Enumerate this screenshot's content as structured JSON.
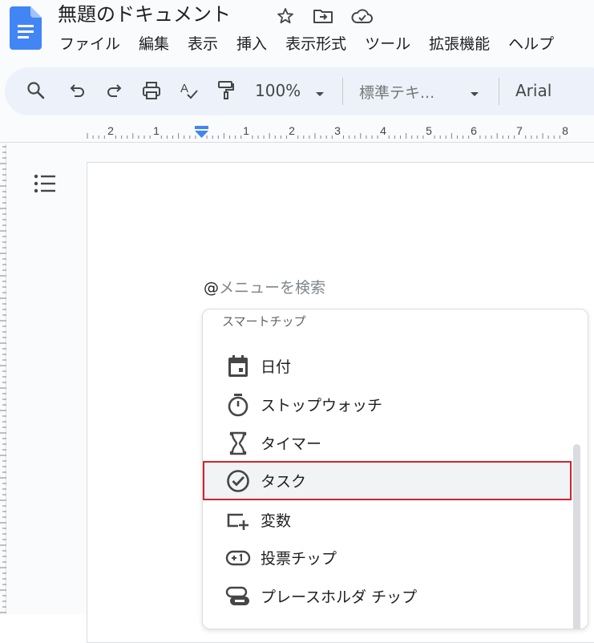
{
  "document": {
    "title": "無題のドキュメント"
  },
  "menu": {
    "items": [
      "ファイル",
      "編集",
      "表示",
      "挿入",
      "表示形式",
      "ツール",
      "拡張機能",
      "ヘルプ"
    ]
  },
  "toolbar": {
    "zoom": "100%",
    "paragraph_style": "標準テキ...",
    "font": "Arial"
  },
  "ruler": {
    "left_labels": [
      "2",
      "1"
    ],
    "right_labels": [
      "1",
      "2",
      "3",
      "4",
      "5",
      "6",
      "7",
      "8"
    ]
  },
  "editor": {
    "at_symbol": "@",
    "search_placeholder": "メニューを検索"
  },
  "smart_chips": {
    "section_label": "スマートチップ",
    "items": [
      {
        "label": "日付",
        "icon": "calendar-icon"
      },
      {
        "label": "ストップウォッチ",
        "icon": "stopwatch-icon"
      },
      {
        "label": "タイマー",
        "icon": "hourglass-icon"
      },
      {
        "label": "タスク",
        "icon": "task-check-icon"
      },
      {
        "label": "変数",
        "icon": "variable-icon"
      },
      {
        "label": "投票チップ",
        "icon": "voting-chip-icon"
      },
      {
        "label": "プレースホルダ チップ",
        "icon": "placeholder-chip-icon"
      }
    ],
    "highlighted_index": 3
  },
  "colors": {
    "accent_blue": "#4285f4",
    "highlight_red": "#d3232f"
  }
}
